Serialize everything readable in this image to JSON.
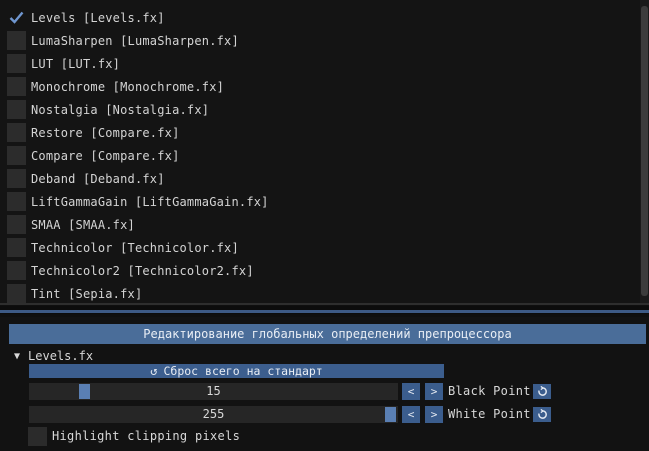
{
  "technique_list": {
    "items": [
      {
        "label": "Levels [Levels.fx]",
        "checked": true
      },
      {
        "label": "LumaSharpen [LumaSharpen.fx]",
        "checked": false
      },
      {
        "label": "LUT [LUT.fx]",
        "checked": false
      },
      {
        "label": "Monochrome [Monochrome.fx]",
        "checked": false
      },
      {
        "label": "Nostalgia [Nostalgia.fx]",
        "checked": false
      },
      {
        "label": "Restore [Compare.fx]",
        "checked": false
      },
      {
        "label": "Compare [Compare.fx]",
        "checked": false
      },
      {
        "label": "Deband [Deband.fx]",
        "checked": false
      },
      {
        "label": "LiftGammaGain [LiftGammaGain.fx]",
        "checked": false
      },
      {
        "label": "SMAA [SMAA.fx]",
        "checked": false
      },
      {
        "label": "Technicolor [Technicolor.fx]",
        "checked": false
      },
      {
        "label": "Technicolor2 [Technicolor2.fx]",
        "checked": false
      },
      {
        "label": "Tint [Sepia.fx]",
        "checked": false
      }
    ]
  },
  "settings": {
    "preprocessor_header": "Редактирование глобальных определений препроцессора",
    "effect_name": "Levels.fx",
    "reset_all_label": "Сброс всего на стандарт",
    "params": [
      {
        "label": "Black Point",
        "value": "15",
        "fraction": 0.08
      },
      {
        "label": "White Point",
        "value": "255",
        "fraction": 1.0
      }
    ],
    "step_down": "<",
    "step_up": ">",
    "highlight_label": "Highlight clipping pixels",
    "highlight_checked": false
  },
  "colors": {
    "accent": "#4a6d99",
    "button": "#3b5d8d",
    "checkmark": "#6f96cf"
  }
}
